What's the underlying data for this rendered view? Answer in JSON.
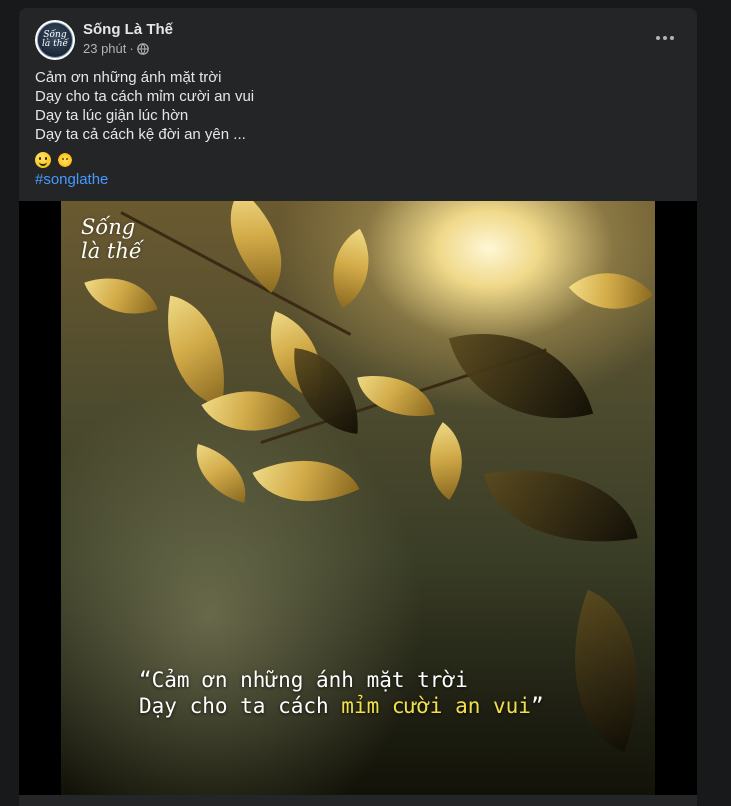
{
  "post": {
    "page_name": "Sống Là Thế",
    "timestamp": "23 phút",
    "separator": "·",
    "privacy_icon": "globe-icon",
    "more_icon": "more-options-icon",
    "avatar_text": [
      "Sống",
      "là thế"
    ],
    "caption_lines": [
      "Cảm ơn những ánh mặt trời",
      "Dạy cho ta cách mỉm cười an vui",
      "Dạy ta lúc giận lúc hờn",
      "Dạy ta cả cách kệ đời an yên ..."
    ],
    "emojis": [
      "smile-emoji",
      "sun-emoji"
    ],
    "hashtag": "#songlathe"
  },
  "photo": {
    "logo_lines": [
      "Sống",
      "là thế"
    ],
    "quote_line1": "“Cảm ơn những ánh mặt trời",
    "quote_line2_prefix": "Dạy cho ta cách ",
    "quote_line2_highlight": "mỉm cười an vui",
    "quote_line2_suffix": "”",
    "highlight_color": "#f2e04a"
  },
  "colors": {
    "background": "#18191a",
    "card": "#242526",
    "text_primary": "#e4e6eb",
    "text_secondary": "#b0b3b8",
    "link": "#4599ff"
  }
}
